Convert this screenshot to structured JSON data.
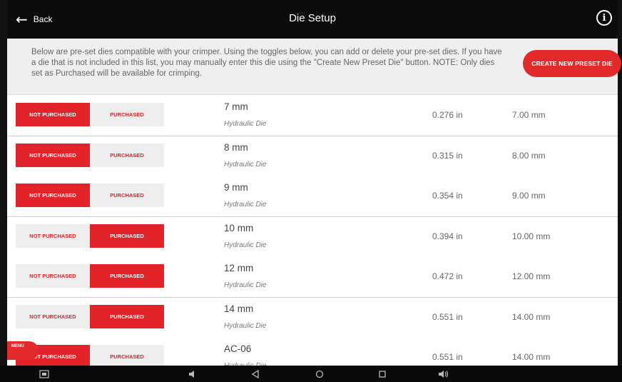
{
  "header": {
    "back_label": "Back",
    "title": "Die Setup",
    "info_glyph": "i"
  },
  "notice": {
    "text": "Below are pre-set dies compatible with your crimper. Using the toggles below, you can add or delete your pre-set dies. If you have a die that is not included in this list, you may manually enter this die using the \"Create New Preset Die\" button. NOTE: Only dies set as Purchased will be available for crimping."
  },
  "create_button": {
    "label": "CREATE NEW PRESET DIE"
  },
  "labels": {
    "not_purchased": "NOT PURCHASED",
    "purchased": "PURCHASED"
  },
  "rows": [
    {
      "size": "7 mm",
      "type": "Hydraulic Die",
      "inches": "0.276 in",
      "mm": "7.00 mm",
      "status": "not_purchased"
    },
    {
      "size": "8 mm",
      "type": "Hydraulic Die",
      "inches": "0.315 in",
      "mm": "8.00 mm",
      "status": "not_purchased"
    },
    {
      "size": "9 mm",
      "type": "Hydraulic Die",
      "inches": "0.354 in",
      "mm": "9.00 mm",
      "status": "not_purchased"
    },
    {
      "size": "10 mm",
      "type": "Hydraulic Die",
      "inches": "0.394 in",
      "mm": "10.00 mm",
      "status": "purchased"
    },
    {
      "size": "12 mm",
      "type": "Hydraulic Die",
      "inches": "0.472 in",
      "mm": "12.00 mm",
      "status": "purchased"
    },
    {
      "size": "14 mm",
      "type": "Hydraulic Die",
      "inches": "0.551 in",
      "mm": "14.00 mm",
      "status": "purchased"
    },
    {
      "size": "AC-06",
      "type": "Hydraulic Die",
      "inches": "0.551 in",
      "mm": "14.00 mm",
      "status": "not_purchased"
    }
  ],
  "menu_tab": {
    "label": "MENU"
  },
  "navbar": {
    "icons": [
      "screenshot-icon",
      "volume-down-icon",
      "back-triangle-icon",
      "home-circle-icon",
      "recents-square-icon",
      "volume-up-icon"
    ]
  },
  "colors": {
    "accent": "#e2232a",
    "topbar": "#0b0b0b",
    "notice_bg": "#efefef"
  }
}
